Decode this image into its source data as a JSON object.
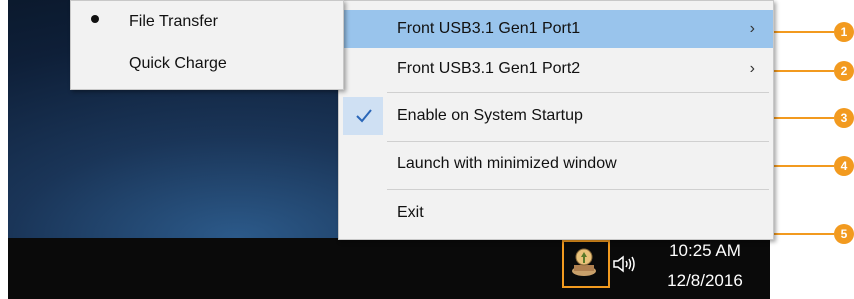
{
  "submenu": {
    "items": [
      {
        "label": "File Transfer",
        "selected": true
      },
      {
        "label": "Quick Charge",
        "selected": false
      }
    ]
  },
  "menu": {
    "items": [
      {
        "label": "Front USB3.1 Gen1 Port1",
        "has_submenu": true,
        "highlighted": true
      },
      {
        "label": "Front USB3.1 Gen1 Port2",
        "has_submenu": true
      },
      {
        "label": "Enable on System Startup",
        "checked": true
      },
      {
        "label": "Launch with minimized window"
      },
      {
        "label": "Exit"
      }
    ]
  },
  "callouts": [
    "1",
    "2",
    "3",
    "4",
    "5"
  ],
  "taskbar": {
    "time": "10:25 AM",
    "date": "12/8/2016",
    "tray_icon": "usb-charger-app-icon",
    "volume_icon": "speaker-icon"
  },
  "colors": {
    "accent": "#f29a1f",
    "highlight": "#99c4ec",
    "taskbar": "#0a0a0a"
  }
}
